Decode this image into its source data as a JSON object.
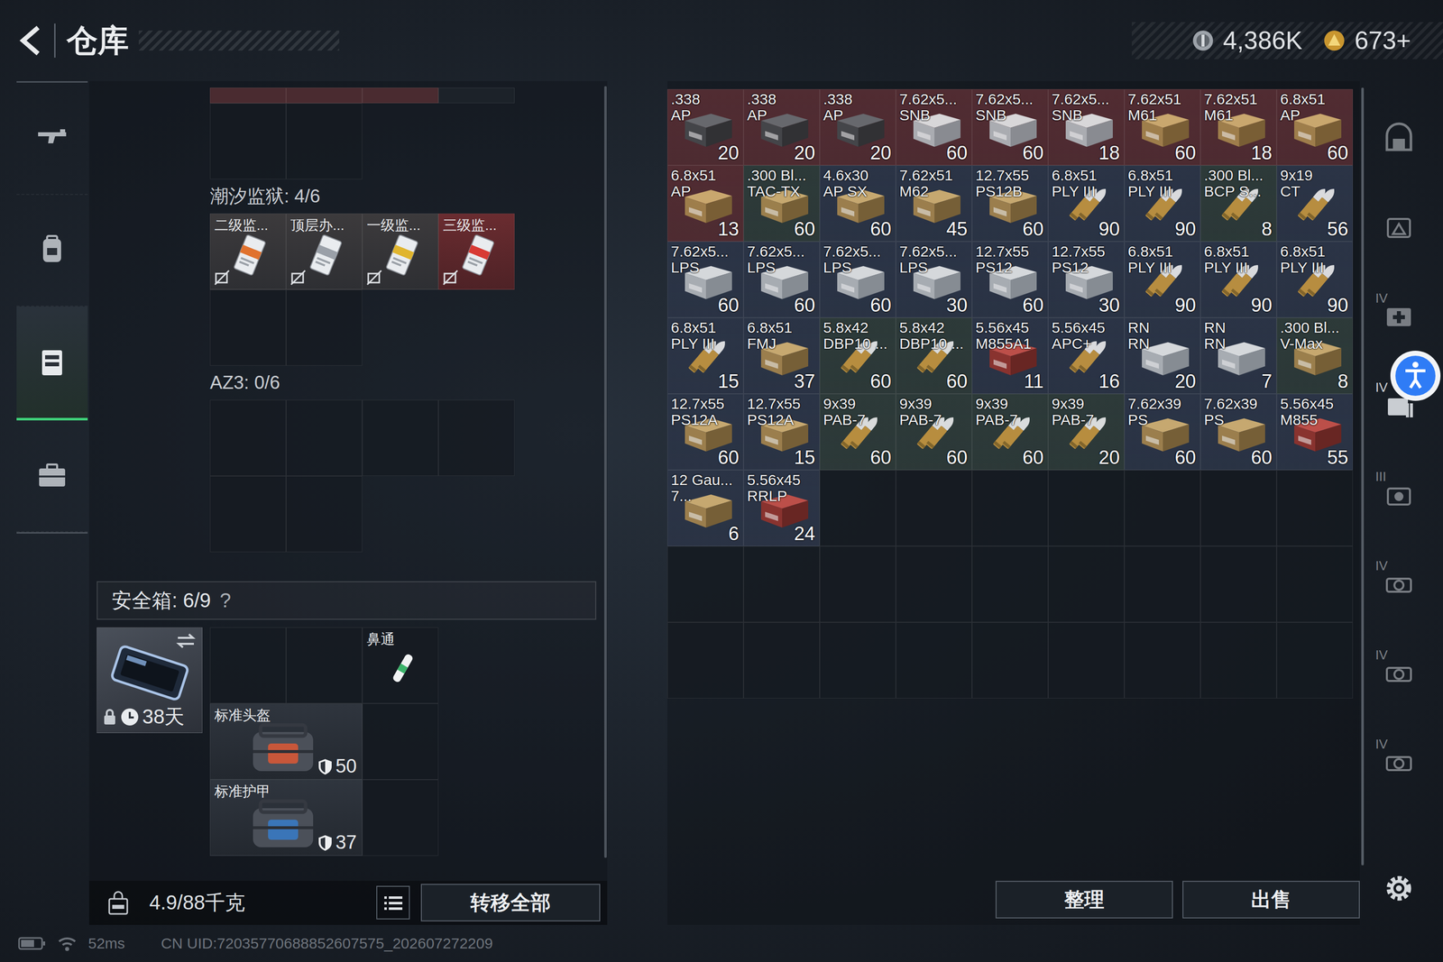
{
  "header": {
    "title": "仓库",
    "currencies": [
      {
        "value": "4,386K",
        "kind": "silver"
      },
      {
        "value": "673+",
        "kind": "gold"
      }
    ]
  },
  "sidebar": {
    "items": [
      {
        "kind": "gun",
        "selected": false
      },
      {
        "kind": "backpack",
        "selected": false
      },
      {
        "kind": "rig",
        "selected": true
      },
      {
        "kind": "case",
        "selected": false
      }
    ]
  },
  "scrolled_top": {
    "cells": [
      {
        "color": "#4a2b30"
      },
      {
        "color": "#4a2b30"
      },
      {
        "color": "#4a2b30"
      },
      {
        "color": "#1c2229"
      }
    ]
  },
  "containers": [
    {
      "title": "潮汐监狱: 4/6",
      "items": [
        {
          "name": "二级监...",
          "color": "#e0722e",
          "kind": "normal"
        },
        {
          "name": "顶层办...",
          "color": "#9aa0a8",
          "kind": "normal"
        },
        {
          "name": "一级监...",
          "color": "#e0b52e",
          "kind": "normal"
        },
        {
          "name": "三级监...",
          "color": "#d83a34",
          "kind": "rare"
        }
      ]
    },
    {
      "title": "AZ3: 0/6",
      "items": []
    }
  ],
  "safe_box": {
    "title": "安全箱: 6/9",
    "help": "?",
    "case_timer": "38天",
    "slots": [
      {
        "kind": "empty"
      },
      {
        "kind": "empty"
      },
      {
        "kind": "small",
        "name": "鼻通"
      },
      {
        "kind": "gear",
        "name": "标准头盔",
        "value": "50"
      },
      {
        "kind": "empty"
      },
      {
        "kind": "gear",
        "name": "标准护甲",
        "value": "37"
      },
      {
        "kind": "empty"
      }
    ]
  },
  "footer": {
    "weight": "4.9/88千克",
    "transfer": "转移全部"
  },
  "stash": {
    "items": [
      {
        "line1": ".338",
        "line2": "AP",
        "count": "20",
        "color": "#512c32",
        "kind": "darkbox"
      },
      {
        "line1": ".338",
        "line2": "AP",
        "count": "20",
        "color": "#512c32",
        "kind": "darkbox"
      },
      {
        "line1": ".338",
        "line2": "AP",
        "count": "20",
        "color": "#512c32",
        "kind": "darkbox"
      },
      {
        "line1": "7.62x5...",
        "line2": "SNB",
        "count": "60",
        "color": "#512c32",
        "kind": "lightbox"
      },
      {
        "line1": "7.62x5...",
        "line2": "SNB",
        "count": "60",
        "color": "#512c32",
        "kind": "lightbox"
      },
      {
        "line1": "7.62x5...",
        "line2": "SNB",
        "count": "18",
        "color": "#512c32",
        "kind": "lightbox"
      },
      {
        "line1": "7.62x51",
        "line2": "M61",
        "count": "60",
        "color": "#512c32",
        "kind": "tanbox"
      },
      {
        "line1": "7.62x51",
        "line2": "M61",
        "count": "18",
        "color": "#512c32",
        "kind": "tanbox"
      },
      {
        "line1": "6.8x51",
        "line2": "AP",
        "count": "60",
        "color": "#512c32",
        "kind": "tanbox"
      },
      {
        "line1": "6.8x51",
        "line2": "AP",
        "count": "13",
        "color": "#512c32",
        "kind": "tanbox"
      },
      {
        "line1": ".300 Bl...",
        "line2": "TAC-TX",
        "count": "60",
        "color": "#2d3a39",
        "kind": "tanbox"
      },
      {
        "line1": "4.6x30",
        "line2": "AP SX",
        "count": "60",
        "color": "#2b3446",
        "kind": "tanbox"
      },
      {
        "line1": "7.62x51",
        "line2": "M62",
        "count": "45",
        "color": "#2b3446",
        "kind": "tanbox"
      },
      {
        "line1": "12.7x55",
        "line2": "PS12B",
        "count": "60",
        "color": "#2b3446",
        "kind": "tanbox"
      },
      {
        "line1": "6.8x51",
        "line2": "PLY III",
        "count": "90",
        "color": "#2b3446",
        "kind": "bullet"
      },
      {
        "line1": "6.8x51",
        "line2": "PLY III",
        "count": "90",
        "color": "#2b3446",
        "kind": "bullet"
      },
      {
        "line1": ".300 Bl...",
        "line2": "BCP S...",
        "count": "8",
        "color": "#2d3a39",
        "kind": "bullet"
      },
      {
        "line1": "9x19",
        "line2": "CT",
        "count": "56",
        "color": "#2b3446",
        "kind": "bullet"
      },
      {
        "line1": "7.62x5...",
        "line2": "LPS",
        "count": "60",
        "color": "#2b3446",
        "kind": "lightbox"
      },
      {
        "line1": "7.62x5...",
        "line2": "LPS",
        "count": "60",
        "color": "#2b3446",
        "kind": "lightbox"
      },
      {
        "line1": "7.62x5...",
        "line2": "LPS",
        "count": "60",
        "color": "#2b3446",
        "kind": "lightbox"
      },
      {
        "line1": "7.62x5...",
        "line2": "LPS",
        "count": "30",
        "color": "#2b3446",
        "kind": "lightbox"
      },
      {
        "line1": "12.7x55",
        "line2": "PS12",
        "count": "60",
        "color": "#2b3446",
        "kind": "lightbox"
      },
      {
        "line1": "12.7x55",
        "line2": "PS12",
        "count": "30",
        "color": "#2b3446",
        "kind": "lightbox"
      },
      {
        "line1": "6.8x51",
        "line2": "PLY III",
        "count": "90",
        "color": "#2b3446",
        "kind": "bullet"
      },
      {
        "line1": "6.8x51",
        "line2": "PLY III",
        "count": "90",
        "color": "#2b3446",
        "kind": "bullet"
      },
      {
        "line1": "6.8x51",
        "line2": "PLY III",
        "count": "90",
        "color": "#2b3446",
        "kind": "bullet"
      },
      {
        "line1": "6.8x51",
        "line2": "PLY III",
        "count": "15",
        "color": "#2b3446",
        "kind": "bullet"
      },
      {
        "line1": "6.8x51",
        "line2": "FMJ",
        "count": "37",
        "color": "#2b3446",
        "kind": "tanbox"
      },
      {
        "line1": "5.8x42",
        "line2": "DBP10 ...",
        "count": "60",
        "color": "#2d3a39",
        "kind": "bullet"
      },
      {
        "line1": "5.8x42",
        "line2": "DBP10 ...",
        "count": "60",
        "color": "#2d3a39",
        "kind": "bullet"
      },
      {
        "line1": "5.56x45",
        "line2": "M855A1",
        "count": "11",
        "color": "#2b3446",
        "kind": "redbox"
      },
      {
        "line1": "5.56x45",
        "line2": "APC+",
        "count": "16",
        "color": "#2b3446",
        "kind": "bullet"
      },
      {
        "line1": "RN",
        "line2": "RN",
        "count": "20",
        "color": "#2b3446",
        "kind": "lightbox"
      },
      {
        "line1": "RN",
        "line2": "RN",
        "count": "7",
        "color": "#2b3446",
        "kind": "lightbox"
      },
      {
        "line1": ".300 Bl...",
        "line2": "V-Max",
        "count": "8",
        "color": "#2d3a39",
        "kind": "tanbox"
      },
      {
        "line1": "12.7x55",
        "line2": "PS12A",
        "count": "60",
        "color": "#2b3446",
        "kind": "tanbox"
      },
      {
        "line1": "12.7x55",
        "line2": "PS12A",
        "count": "15",
        "color": "#2b3446",
        "kind": "tanbox"
      },
      {
        "line1": "9x39",
        "line2": "PAB-7",
        "count": "60",
        "color": "#2d3a39",
        "kind": "bullet"
      },
      {
        "line1": "9x39",
        "line2": "PAB-7",
        "count": "60",
        "color": "#2d3a39",
        "kind": "bullet"
      },
      {
        "line1": "9x39",
        "line2": "PAB-7",
        "count": "60",
        "color": "#2d3a39",
        "kind": "bullet"
      },
      {
        "line1": "9x39",
        "line2": "PAB-7",
        "count": "20",
        "color": "#2d3a39",
        "kind": "bullet"
      },
      {
        "line1": "7.62x39",
        "line2": "PS",
        "count": "60",
        "color": "#2b3446",
        "kind": "tanbox"
      },
      {
        "line1": "7.62x39",
        "line2": "PS",
        "count": "60",
        "color": "#2b3446",
        "kind": "tanbox"
      },
      {
        "line1": "5.56x45",
        "line2": "M855",
        "count": "55",
        "color": "#2b3446",
        "kind": "redbox"
      },
      {
        "line1": "12 Gau...",
        "line2": "7...",
        "count": "6",
        "color": "#2b3446",
        "kind": "tanbox"
      },
      {
        "line1": "5.56x45",
        "line2": "RRLP",
        "count": "24",
        "color": "#2b3446",
        "kind": "redbox"
      }
    ]
  },
  "stash_buttons": [
    "整理",
    "出售"
  ],
  "right_tabs": [
    {
      "kind": "garage",
      "selected": false
    },
    {
      "kind": "gti",
      "selected": false
    },
    {
      "kind": "medkit",
      "label": "IV",
      "selected": false
    },
    {
      "kind": "ammo",
      "label": "IV",
      "selected": true
    },
    {
      "kind": "grenade",
      "label": "III",
      "selected": false
    },
    {
      "kind": "scope",
      "label": "IV",
      "selected": false
    },
    {
      "kind": "scope",
      "label": "IV",
      "selected": false
    },
    {
      "kind": "scope",
      "label": "IV",
      "selected": false
    }
  ],
  "status_bar": {
    "ping": "52ms",
    "uid": "CN UID:72035770688852607575_202607272209"
  }
}
